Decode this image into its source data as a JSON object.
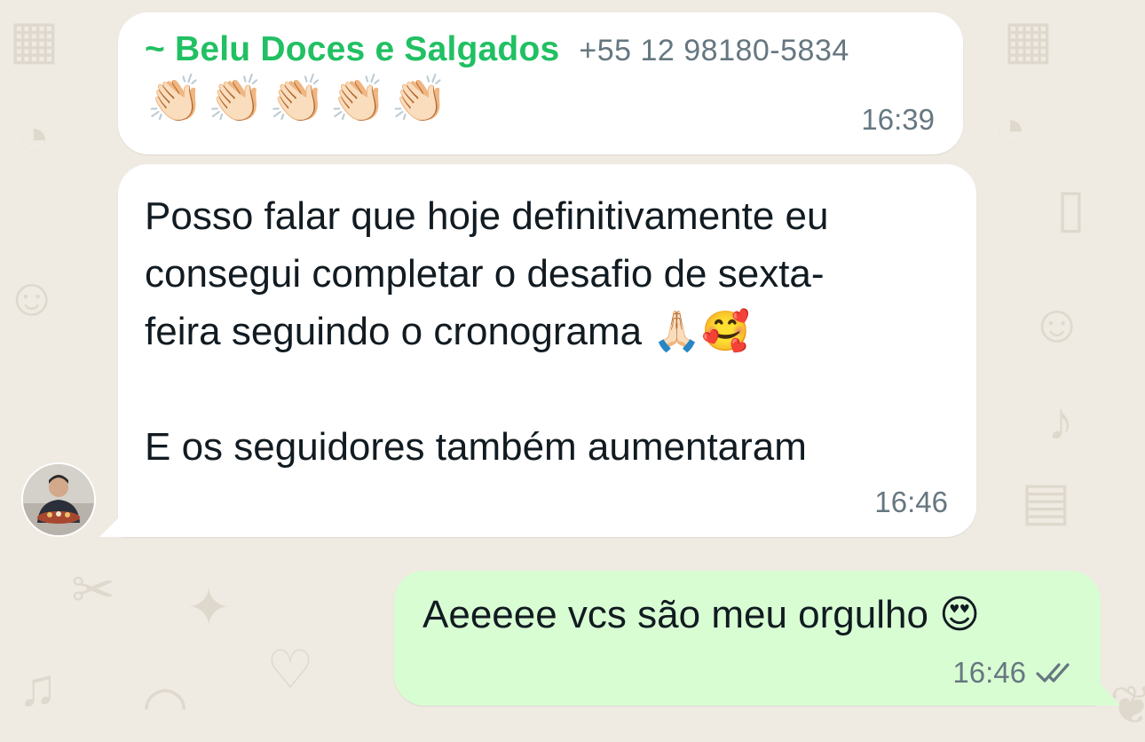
{
  "colors": {
    "wallpaper": "#efeae2",
    "incoming_bubble": "#ffffff",
    "outgoing_bubble": "#d9fdd3",
    "sender_name": "#21c063",
    "meta_text": "#667781",
    "read_ticks": "#667781"
  },
  "messages": [
    {
      "direction": "incoming",
      "sender_name": "~ Belu Doces e Salgados",
      "sender_phone": "+55 12 98180-5834",
      "text": "👏🏻👏🏻👏🏻👏🏻👏🏻",
      "time": "16:39"
    },
    {
      "direction": "incoming",
      "text": "Posso falar que hoje definitivamente eu\nconsegui completar o desafio de sexta-\nfeira seguindo o cronograma 🙏🏻🥰\n\nE os seguidores também aumentaram",
      "time": "16:46",
      "avatar_icon": "contact-avatar"
    },
    {
      "direction": "outgoing",
      "text": "Aeeeee vcs são meu orgulho 😍",
      "time": "16:46",
      "status_icon": "double-check-read-icon"
    }
  ]
}
